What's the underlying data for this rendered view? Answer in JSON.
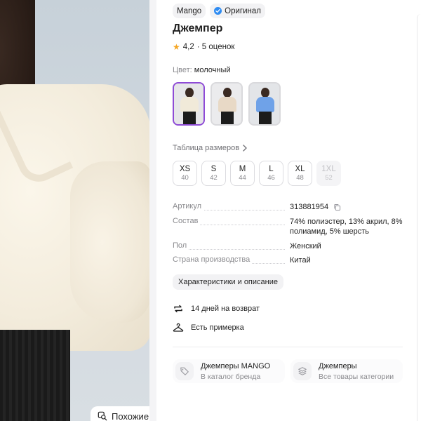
{
  "product": {
    "brand": "Mango",
    "original_label": "Оригинал",
    "title": "Джемпер",
    "rating": "4,2",
    "reviews": "· 5 оценок",
    "color_label": "Цвет:",
    "color_value": "молочный"
  },
  "variants": [
    {
      "name": "milky",
      "selected": true,
      "body_color": "#f1ead9",
      "bg": "#e6e6e8"
    },
    {
      "name": "beige",
      "selected": false,
      "body_color": "#e8d9c6",
      "bg": "#ebebed"
    },
    {
      "name": "blue",
      "selected": false,
      "body_color": "#6fa2e8",
      "bg": "#e3e5e8"
    }
  ],
  "size_table_link": "Таблица размеров",
  "sizes": [
    {
      "label": "XS",
      "ru": "40",
      "available": true
    },
    {
      "label": "S",
      "ru": "42",
      "available": true
    },
    {
      "label": "M",
      "ru": "44",
      "available": true
    },
    {
      "label": "L",
      "ru": "46",
      "available": true
    },
    {
      "label": "XL",
      "ru": "48",
      "available": true
    },
    {
      "label": "1XL",
      "ru": "52",
      "available": false
    }
  ],
  "specs": [
    {
      "key": "Артикул",
      "value": "313881954"
    },
    {
      "key": "Состав",
      "value": "74% полиэстер, 13% акрил, 8% полиамид, 5% шерсть"
    },
    {
      "key": "Пол",
      "value": "Женский"
    },
    {
      "key": "Страна производства",
      "value": "Китай"
    }
  ],
  "characteristics_button": "Характеристики и описание",
  "features": {
    "return": "14 дней на возврат",
    "fitting": "Есть примерка"
  },
  "cards": {
    "brand": {
      "title": "Джемперы MANGO",
      "subtitle": "В каталог бренда"
    },
    "category": {
      "title": "Джемперы",
      "subtitle": "Все товары категории"
    }
  },
  "similar_button": "Похожие",
  "colors": {
    "accent_purple": "#8e4bd6",
    "star": "#f5a623",
    "verified_blue": "#2f8cf2"
  }
}
